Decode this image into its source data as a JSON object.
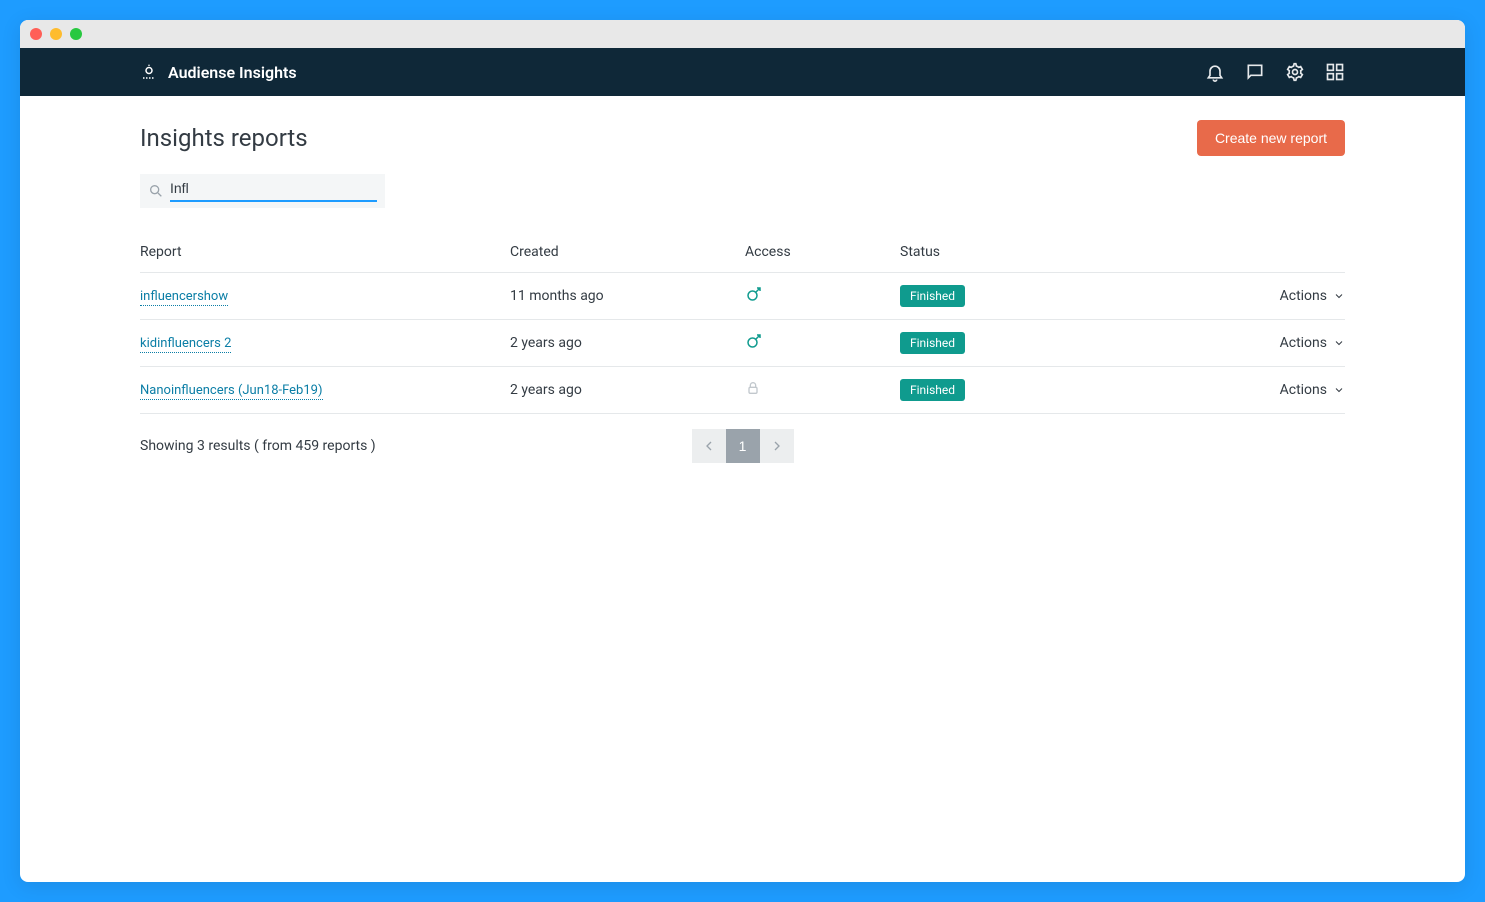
{
  "brand": {
    "name": "Audiense Insights"
  },
  "page": {
    "title": "Insights reports",
    "create_label": "Create new report"
  },
  "search": {
    "value": "Infl"
  },
  "columns": {
    "report": "Report",
    "created": "Created",
    "access": "Access",
    "status": "Status"
  },
  "rows": [
    {
      "name": "influencershow",
      "created": "11 months ago",
      "access": "public",
      "status": "Finished",
      "actions": "Actions"
    },
    {
      "name": "kidinfluencers 2",
      "created": "2 years ago",
      "access": "public",
      "status": "Finished",
      "actions": "Actions"
    },
    {
      "name": "Nanoinfluencers (Jun18-Feb19)",
      "created": "2 years ago",
      "access": "locked",
      "status": "Finished",
      "actions": "Actions"
    }
  ],
  "pagination": {
    "current": "1",
    "results_text": "Showing 3 results ( from 459 reports )"
  }
}
